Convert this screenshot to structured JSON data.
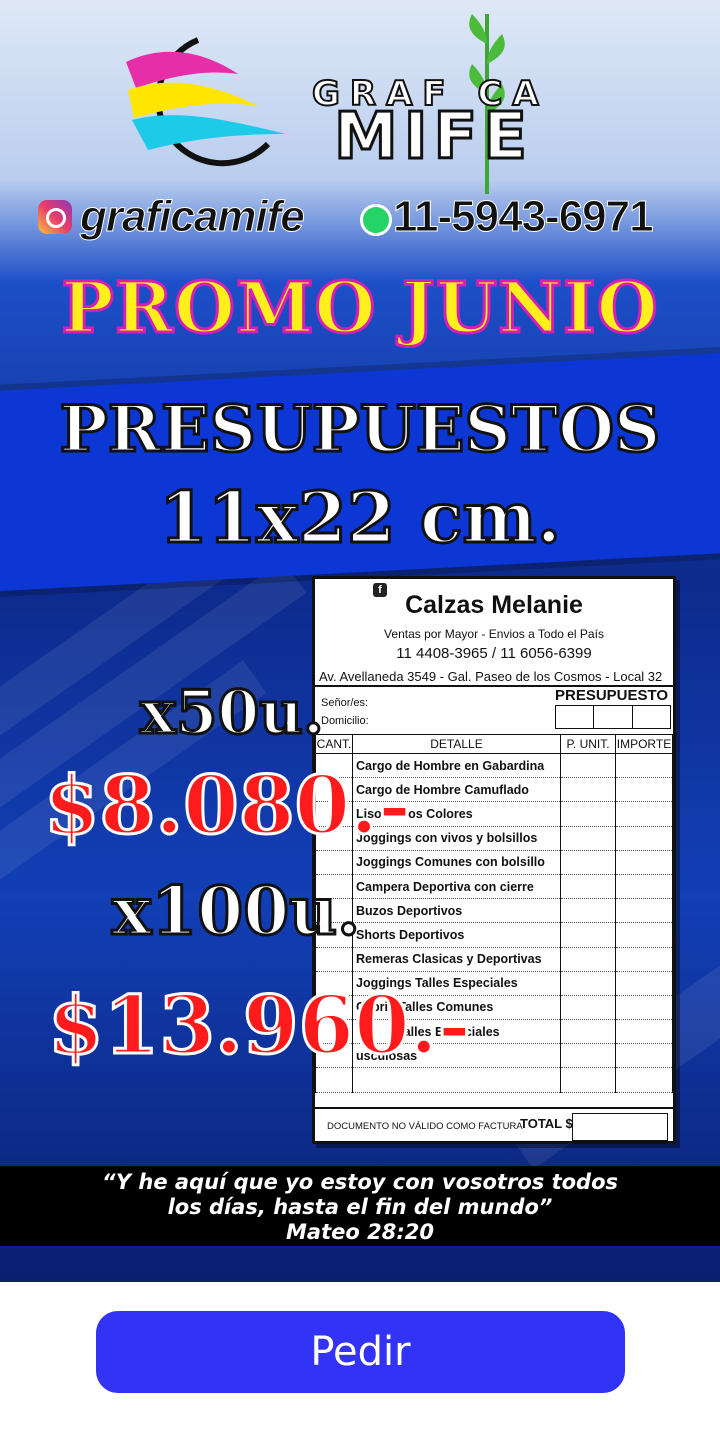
{
  "poster": {
    "brand": {
      "top": "GRAF CA",
      "main": "MIFE"
    },
    "social": {
      "handle": "graficamife",
      "phone": "11-5943-6971",
      "instagram_icon": "instagram-icon",
      "whatsapp_icon": "whatsapp-icon"
    },
    "promo_title": "PROMO JUNIO",
    "headline": {
      "line1": "PRESUPUESTOS",
      "line2": "11x22 cm."
    },
    "offers": [
      {
        "qty": "x50u.",
        "price": "$8.080.-"
      },
      {
        "qty": "x100u.",
        "price": "$13.960.-"
      }
    ],
    "document": {
      "title": "Calzas Melanie",
      "facebook_icon": "facebook-icon",
      "subtitle": "Ventas por Mayor - Envios a Todo el País",
      "phones": "11 4408-3965 / 11 6056-6399",
      "address": "Av. Avellaneda 3549 - Gal. Paseo de los Cosmos - Local 32",
      "senor_label": "Señor/es:",
      "domicilio_label": "Domicilio:",
      "presupuesto": "PRESUPUESTO",
      "columns": [
        "CANT.",
        "DETALLE",
        "P. UNIT.",
        "IMPORTE"
      ],
      "rows": [
        "Cargo de Hombre en Gabardina",
        "Cargo de Hombre Camuflado",
        "Liso Varios Colores",
        "Joggings con vivos y bolsillos",
        "Joggings Comunes con bolsillo",
        "Campera Deportiva con cierre",
        "Buzos Deportivos",
        "Shorts Deportivos",
        "Remeras Clasicas y Deportivas",
        "Joggings Talles Especiales",
        "Capris Talles Comunes",
        "Talles Especiales",
        "usculosas",
        "",
        ""
      ],
      "footer_note": "DOCUMENTO NO VÁLIDO COMO FACTURA",
      "total_label": "TOTAL $"
    },
    "quote": {
      "line1": "“Y he aquí que yo estoy con vosotros todos",
      "line2": "los días, hasta el fin del mundo”",
      "line3": "Mateo 28:20"
    },
    "colors": {
      "promo_fill": "#ffef1a",
      "promo_outline": "#d51fb4",
      "price": "#ff1b1b",
      "button": "#3233f4"
    }
  },
  "action": {
    "button_label": "Pedir"
  }
}
